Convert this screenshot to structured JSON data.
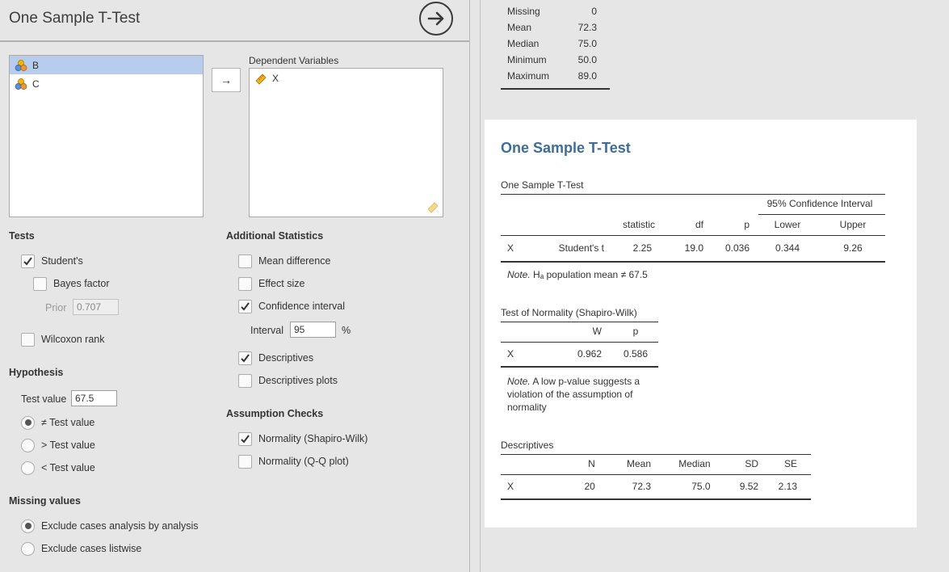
{
  "options": {
    "title": "One Sample T-Test",
    "variables": [
      {
        "name": "B",
        "selected": true
      },
      {
        "name": "C",
        "selected": false
      }
    ],
    "dependent_label": "Dependent Variables",
    "dependent": [
      {
        "name": "X"
      }
    ],
    "assign_arrow": "→",
    "tests": {
      "title": "Tests",
      "students": {
        "label": "Student's",
        "checked": true
      },
      "bayes": {
        "label": "Bayes factor",
        "checked": false
      },
      "prior_label": "Prior",
      "prior_value": "0.707",
      "wilcoxon": {
        "label": "Wilcoxon rank",
        "checked": false
      }
    },
    "hypothesis": {
      "title": "Hypothesis",
      "test_value_label": "Test value",
      "test_value": "67.5",
      "options": [
        {
          "label": "≠ Test value",
          "selected": true
        },
        {
          "label": "> Test value",
          "selected": false
        },
        {
          "label": "< Test value",
          "selected": false
        }
      ]
    },
    "missing": {
      "title": "Missing values",
      "options": [
        {
          "label": "Exclude cases analysis by analysis",
          "selected": true
        },
        {
          "label": "Exclude cases listwise",
          "selected": false
        }
      ]
    },
    "additional": {
      "title": "Additional Statistics",
      "mean_diff": {
        "label": "Mean difference",
        "checked": false
      },
      "effect_size": {
        "label": "Effect size",
        "checked": false
      },
      "ci": {
        "label": "Confidence interval",
        "checked": true
      },
      "interval_label": "Interval",
      "interval_value": "95",
      "interval_unit": "%",
      "descriptives": {
        "label": "Descriptives",
        "checked": true
      },
      "desc_plots": {
        "label": "Descriptives plots",
        "checked": false
      }
    },
    "assumption": {
      "title": "Assumption Checks",
      "normality_sw": {
        "label": "Normality (Shapiro-Wilk)",
        "checked": true
      },
      "normality_qq": {
        "label": "Normality (Q-Q plot)",
        "checked": false
      }
    }
  },
  "results": {
    "prev_descriptives": [
      {
        "label": "Missing",
        "value": "0"
      },
      {
        "label": "Mean",
        "value": "72.3"
      },
      {
        "label": "Median",
        "value": "75.0"
      },
      {
        "label": "Minimum",
        "value": "50.0"
      },
      {
        "label": "Maximum",
        "value": "89.0"
      }
    ],
    "title": "One Sample T-Test",
    "ttest": {
      "caption": "One Sample T-Test",
      "ci_header": "95% Confidence Interval",
      "headers": [
        "",
        "",
        "statistic",
        "df",
        "p",
        "Lower",
        "Upper"
      ],
      "rows": [
        [
          "X",
          "Student's t",
          "2.25",
          "19.0",
          "0.036",
          "0.344",
          "9.26"
        ]
      ],
      "note_prefix": "Note.",
      "note_text": "Hₐ population mean ≠ 67.5"
    },
    "normality": {
      "caption": "Test of Normality (Shapiro-Wilk)",
      "headers": [
        "",
        "W",
        "p"
      ],
      "rows": [
        [
          "X",
          "0.962",
          "0.586"
        ]
      ],
      "note_prefix": "Note.",
      "note_line1": "A low p-value suggests a",
      "note_line2": "violation of the assumption of",
      "note_line3": "normality"
    },
    "descriptives": {
      "caption": "Descriptives",
      "headers": [
        "",
        "N",
        "Mean",
        "Median",
        "SD",
        "SE"
      ],
      "rows": [
        [
          "X",
          "20",
          "72.3",
          "75.0",
          "9.52",
          "2.13"
        ]
      ]
    }
  }
}
